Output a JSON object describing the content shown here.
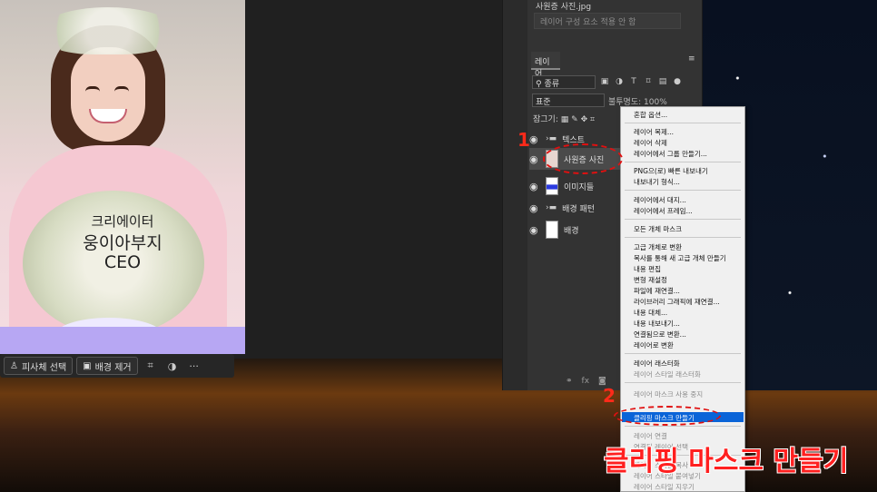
{
  "document": {
    "line1": "크리에이터",
    "line2": "웅이아부지",
    "line3": "CEO"
  },
  "taskbar": {
    "select_subject": "피사체 선택",
    "remove_bg": "배경 제거",
    "more": "···"
  },
  "properties": {
    "file_name": "사원증 사진.jpg",
    "layer_comp": "레이어 구성 요소 적용 안 함"
  },
  "layers_panel": {
    "tab": "레이어",
    "filter_kind": "종류",
    "blend_mode": "표준",
    "opacity": "불투명도: 100%",
    "lock": "잠그기:",
    "layers": [
      {
        "name": "텍스트",
        "type": "folder"
      },
      {
        "name": "사원증 사진",
        "type": "image"
      },
      {
        "name": "이미지들",
        "type": "image"
      },
      {
        "name": "배경 패턴",
        "type": "folder"
      },
      {
        "name": "배경",
        "type": "fill"
      }
    ],
    "footer_fx": "fx"
  },
  "context_menu": {
    "items": [
      {
        "label": "혼합 옵션...",
        "disabled": false
      },
      {
        "label": "레이어 복제...",
        "disabled": false
      },
      {
        "label": "레이어 삭제",
        "disabled": false
      },
      {
        "label": "레이어에서 그룹 만들기...",
        "disabled": false
      },
      {
        "label": "PNG으(로) 빠른 내보내기",
        "disabled": false
      },
      {
        "label": "내보내기 형식...",
        "disabled": false
      },
      {
        "label": "레이어에서 대지...",
        "disabled": false
      },
      {
        "label": "레이어에서 프레임...",
        "disabled": false
      },
      {
        "label": "모든 개체 마스크",
        "disabled": false
      },
      {
        "label": "고급 개체로 변환",
        "disabled": false
      },
      {
        "label": "복사를 통해 새 고급 개체 만들기",
        "disabled": false
      },
      {
        "label": "내용 편집",
        "disabled": false
      },
      {
        "label": "변형 재설정",
        "disabled": false
      },
      {
        "label": "파일에 재연결...",
        "disabled": false
      },
      {
        "label": "라이브러리 그래픽에 재연결...",
        "disabled": false
      },
      {
        "label": "내용 대체...",
        "disabled": false
      },
      {
        "label": "내용 내보내기...",
        "disabled": false
      },
      {
        "label": "연결됨으로 변환...",
        "disabled": false
      },
      {
        "label": "레이어로 변환",
        "disabled": false
      },
      {
        "label": "레이어 래스터화",
        "disabled": false
      },
      {
        "label": "레이어 스타일 래스터화",
        "disabled": true
      },
      {
        "label": "레이어 마스크 사용 중지",
        "disabled": true
      },
      {
        "label": "클리핑 마스크 만들기",
        "disabled": false,
        "highlighted": true
      },
      {
        "label": "레이어 연결",
        "disabled": true
      },
      {
        "label": "연결된 레이어 선택",
        "disabled": true
      },
      {
        "label": "레이어 스타일 복사",
        "disabled": true
      },
      {
        "label": "레이어 스타일 붙여넣기",
        "disabled": true
      },
      {
        "label": "레이어 스타일 지우기",
        "disabled": true
      }
    ]
  },
  "annotations": {
    "step1": "1",
    "step2": "2",
    "caption": "클리핑 마스크 만들기"
  }
}
